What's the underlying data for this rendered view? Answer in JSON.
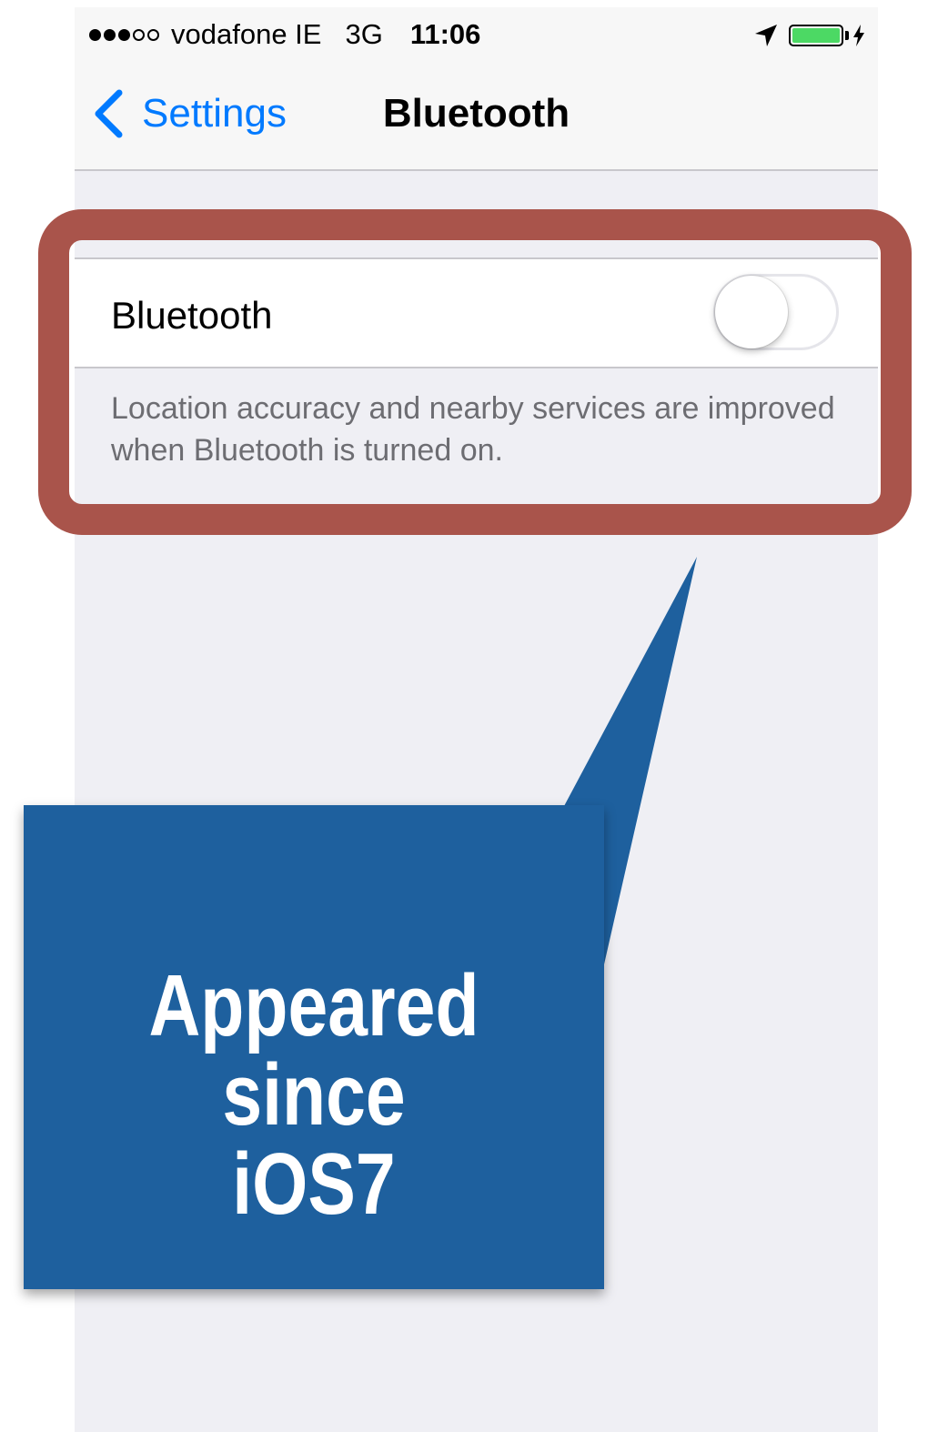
{
  "status_bar": {
    "signal_dots_filled": 3,
    "signal_dots_total": 5,
    "carrier": "vodafone IE",
    "network": "3G",
    "time": "11:06",
    "icons": [
      "location-arrow-icon",
      "battery-icon",
      "charging-bolt-icon"
    ],
    "battery_level": 1.0
  },
  "nav": {
    "back_label": "Settings",
    "title": "Bluetooth"
  },
  "bluetooth": {
    "label": "Bluetooth",
    "enabled": false,
    "footer": "Location accuracy and nearby services are improved when Bluetooth is turned on."
  },
  "annotation": {
    "text": "Appeared since iOS7",
    "line1": "Appeared since",
    "line2": "iOS7"
  },
  "colors": {
    "accent": "#007aff",
    "highlight_border": "#a9544b",
    "callout_bg": "#1e609e",
    "battery": "#4cd964",
    "background": "#efeff4"
  }
}
